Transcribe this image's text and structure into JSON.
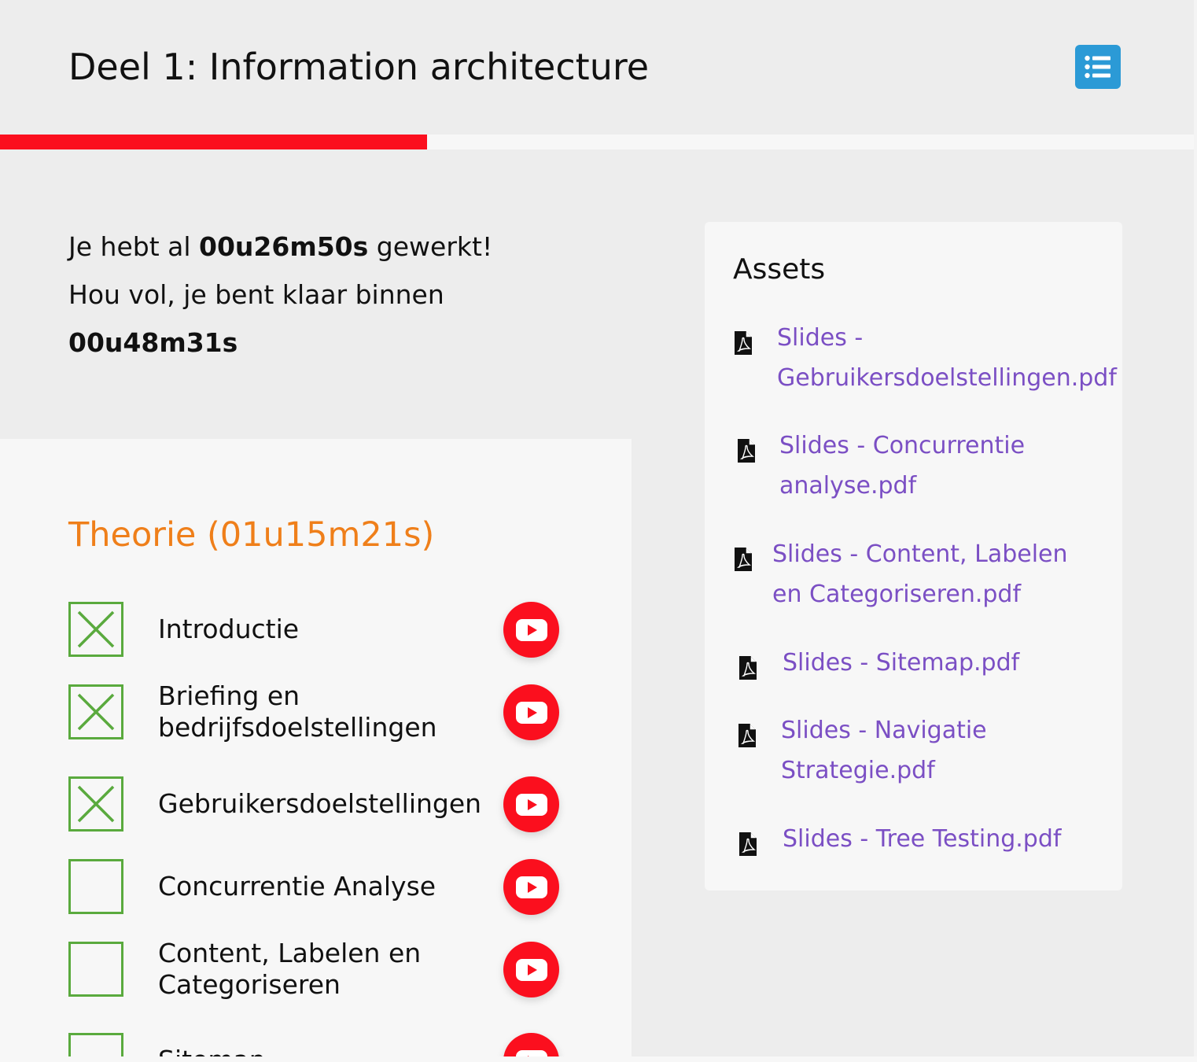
{
  "header": {
    "title": "Deel 1: Information architecture",
    "menu_icon": "list-icon"
  },
  "progress": {
    "fraction": 0.358
  },
  "time_info": {
    "prefix": "Je hebt al ",
    "worked": "00u26m50s",
    "suffix": " gewerkt!",
    "remaining_label": "Hou vol, je bent klaar binnen",
    "remaining": "00u48m31s"
  },
  "theory": {
    "title": "Theorie (01u15m21s)",
    "lessons": [
      {
        "label": "Introductie",
        "done": true
      },
      {
        "label": "Briefing en bedrijfsdoelstellingen",
        "done": true
      },
      {
        "label": "Gebruikersdoelstellingen",
        "done": true
      },
      {
        "label": "Concurrentie Analyse",
        "done": false
      },
      {
        "label": "Content, Labelen en Categoriseren",
        "done": false
      },
      {
        "label": "Sitemap",
        "done": false
      }
    ]
  },
  "assets": {
    "title": "Assets",
    "files": [
      "Slides - Gebruikersdoelstellingen.pdf",
      "Slides - Concurrentie analyse.pdf",
      "Slides - Content, Labelen en Categoriseren.pdf",
      "Slides - Sitemap.pdf",
      "Slides - Navigatie Strategie.pdf",
      "Slides - Tree Testing.pdf"
    ]
  },
  "colors": {
    "progress": "#fb0f1e",
    "menu_button": "#2b9ad6",
    "theory_title": "#ef7f1a",
    "check_green": "#5aaa3e",
    "youtube_red": "#fb0f1e",
    "link_purple": "#7b4fc4"
  }
}
